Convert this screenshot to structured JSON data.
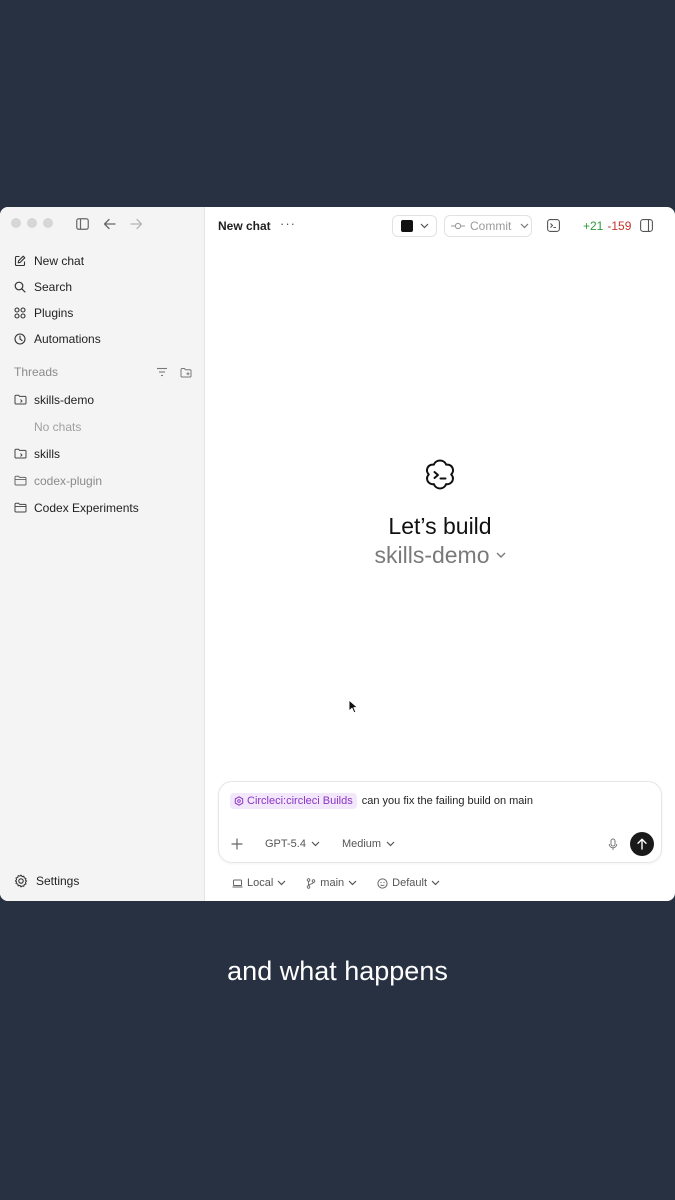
{
  "sidebar": {
    "nav": [
      {
        "label": "New chat",
        "icon": "compose-icon"
      },
      {
        "label": "Search",
        "icon": "search-icon"
      },
      {
        "label": "Plugins",
        "icon": "grid-icon"
      },
      {
        "label": "Automations",
        "icon": "clock-icon"
      }
    ],
    "threads_label": "Threads",
    "threads": [
      {
        "label": "skills-demo",
        "icon": "repo-folder-icon"
      },
      {
        "label": "skills",
        "icon": "repo-folder-icon"
      },
      {
        "label": "codex-plugin",
        "icon": "folder-icon"
      },
      {
        "label": "Codex Experiments",
        "icon": "folder-icon"
      }
    ],
    "no_chats": "No chats",
    "settings_label": "Settings"
  },
  "header": {
    "title": "New chat",
    "more": "···",
    "commit_label": "Commit",
    "diff_added": "+21",
    "diff_removed": "-159"
  },
  "hero": {
    "heading": "Let’s build",
    "project": "skills-demo"
  },
  "composer": {
    "mention": "Circleci:circleci Builds",
    "message": "can you fix the failing build on main",
    "model": "GPT-5.4",
    "reasoning": "Medium"
  },
  "footer": {
    "environment": "Local",
    "branch": "main",
    "permissions": "Default"
  },
  "caption": "and what happens",
  "colors": {
    "background": "#283142",
    "diff_added": "#2c9a3a",
    "diff_removed": "#c4342b",
    "mention_chip_bg": "#f3e7fb",
    "mention_chip_text": "#8a34c7"
  }
}
